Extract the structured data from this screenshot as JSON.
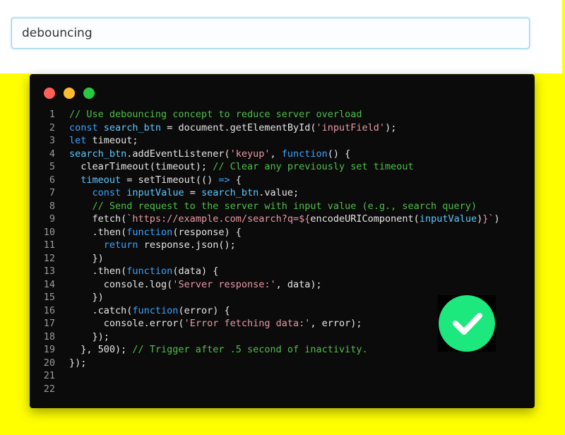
{
  "search": {
    "value": "debouncing"
  },
  "window": {
    "dot_colors": [
      "#ff5f57",
      "#febc2e",
      "#28c840"
    ]
  },
  "badge": {
    "icon": "check-circle-icon",
    "color": "#1ce87e"
  },
  "code": {
    "lines": [
      {
        "n": "1",
        "tokens": [
          [
            "comment",
            "// Use debouncing concept to reduce server overload"
          ]
        ]
      },
      {
        "n": "2",
        "tokens": [
          [
            "kw",
            "const "
          ],
          [
            "var",
            "search_btn"
          ],
          [
            "punc",
            " = document.getElementById("
          ],
          [
            "str",
            "'inputField'"
          ],
          [
            "punc",
            ");"
          ]
        ]
      },
      {
        "n": "3",
        "tokens": [
          [
            "kw",
            "let "
          ],
          [
            "punc",
            "timeout;"
          ]
        ]
      },
      {
        "n": "4",
        "tokens": [
          [
            "var",
            "search_btn"
          ],
          [
            "punc",
            ".addEventListener("
          ],
          [
            "str",
            "'keyup'"
          ],
          [
            "punc",
            ", "
          ],
          [
            "kw",
            "function"
          ],
          [
            "punc",
            "() {"
          ]
        ]
      },
      {
        "n": "5",
        "tokens": [
          [
            "punc",
            "  clearTimeout(timeout); "
          ],
          [
            "comment",
            "// Clear any previously set timeout"
          ]
        ]
      },
      {
        "n": "6",
        "tokens": [
          [
            "punc",
            "  "
          ],
          [
            "var",
            "timeout"
          ],
          [
            "punc",
            " = setTimeout(() "
          ],
          [
            "kw",
            "=>"
          ],
          [
            "punc",
            " {"
          ]
        ]
      },
      {
        "n": "7",
        "tokens": [
          [
            "punc",
            "    "
          ],
          [
            "kw",
            "const "
          ],
          [
            "var",
            "inputValue"
          ],
          [
            "punc",
            " = "
          ],
          [
            "var",
            "search_btn"
          ],
          [
            "punc",
            ".value;"
          ]
        ]
      },
      {
        "n": "8",
        "tokens": [
          [
            "comment",
            "    // Send request to the server with input value (e.g., search query)"
          ]
        ]
      },
      {
        "n": "9",
        "tokens": [
          [
            "punc",
            "    fetch("
          ],
          [
            "str",
            "`https://example.com/search?q=${"
          ],
          [
            "punc",
            "encodeURIComponent("
          ],
          [
            "var",
            "inputValue"
          ],
          [
            "punc",
            ")"
          ],
          [
            "str",
            "}`"
          ],
          [
            "punc",
            ")"
          ]
        ]
      },
      {
        "n": "10",
        "tokens": [
          [
            "punc",
            "    .then("
          ],
          [
            "kw",
            "function"
          ],
          [
            "punc",
            "(response) {"
          ]
        ]
      },
      {
        "n": "11",
        "tokens": [
          [
            "punc",
            "      "
          ],
          [
            "kw",
            "return "
          ],
          [
            "punc",
            "response.json();"
          ]
        ]
      },
      {
        "n": "12",
        "tokens": [
          [
            "punc",
            "    })"
          ]
        ]
      },
      {
        "n": "13",
        "tokens": [
          [
            "punc",
            "    .then("
          ],
          [
            "kw",
            "function"
          ],
          [
            "punc",
            "(data) {"
          ]
        ]
      },
      {
        "n": "14",
        "tokens": [
          [
            "punc",
            "      console.log("
          ],
          [
            "str",
            "'Server response:'"
          ],
          [
            "punc",
            ", data);"
          ]
        ]
      },
      {
        "n": "15",
        "tokens": [
          [
            "punc",
            "    })"
          ]
        ]
      },
      {
        "n": "16",
        "tokens": [
          [
            "punc",
            "    .catch("
          ],
          [
            "kw",
            "function"
          ],
          [
            "punc",
            "(error) {"
          ]
        ]
      },
      {
        "n": "17",
        "tokens": [
          [
            "punc",
            "      console.error("
          ],
          [
            "str",
            "'Error fetching data:'"
          ],
          [
            "punc",
            ", error);"
          ]
        ]
      },
      {
        "n": "18",
        "tokens": [
          [
            "punc",
            "    });"
          ]
        ]
      },
      {
        "n": "19",
        "tokens": [
          [
            "punc",
            "  }, 500); "
          ],
          [
            "comment",
            "// Trigger after .5 second of inactivity."
          ]
        ]
      },
      {
        "n": "20",
        "tokens": [
          [
            "punc",
            "});"
          ]
        ]
      },
      {
        "n": "21",
        "tokens": []
      },
      {
        "n": "22",
        "tokens": []
      }
    ]
  }
}
